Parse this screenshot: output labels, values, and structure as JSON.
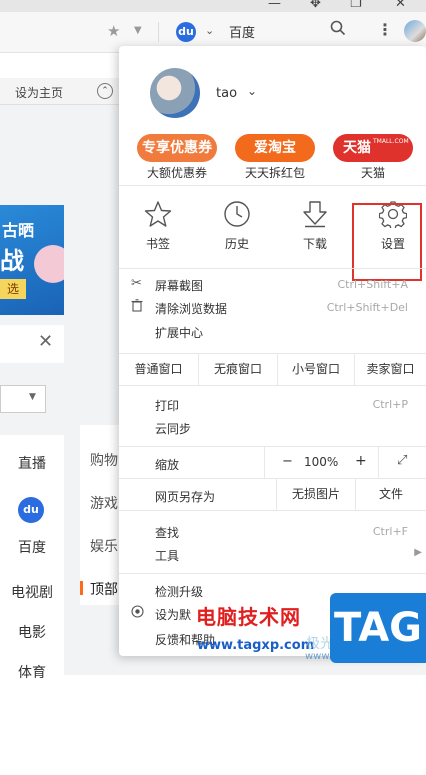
{
  "browser": {
    "address_bar": {
      "star_icon": "star-icon",
      "dropdown_icon": "caret-down-icon"
    },
    "search_engine": {
      "name": "百度",
      "icon": "baidu-paw-icon",
      "icon_text": "du"
    },
    "toolbar": {
      "search_icon": "magnifier-icon",
      "more_icon": "vertical-dots-icon",
      "avatar": "user-avatar"
    },
    "window_controls": {
      "icons": [
        "minimize-icon",
        "pin-icon",
        "restore-icon",
        "close-icon"
      ]
    },
    "bookmarks_bar": {
      "set_home_label": "设为主页",
      "arrow_icon": "circle-arrow-up-icon"
    }
  },
  "page": {
    "banner": {
      "line1": "古晒",
      "line2": "战",
      "button": "选"
    },
    "close_icon": "close-icon",
    "side_nav": [
      "直播",
      "百度",
      "电视剧",
      "电影",
      "体育"
    ],
    "baidu_icon_text": "du",
    "mid_nav": [
      "购物",
      "游戏",
      "娱乐",
      "顶部"
    ]
  },
  "menu": {
    "profile": {
      "username": "tao",
      "caret_icon": "chevron-down-icon"
    },
    "promos": [
      {
        "badge": "专享优惠券",
        "caption": "大额优惠券",
        "color": "#f07b3c"
      },
      {
        "badge": "爱淘宝",
        "caption": "天天拆红包",
        "color": "#f26a1b"
      },
      {
        "badge": "天猫",
        "sub_badge": "TMALL.COM",
        "caption": "天猫",
        "color": "#e0322c"
      }
    ],
    "tools": [
      {
        "label": "书签",
        "icon": "star-outline-icon"
      },
      {
        "label": "历史",
        "icon": "clock-icon"
      },
      {
        "label": "下载",
        "icon": "download-icon"
      },
      {
        "label": "设置",
        "icon": "gear-icon"
      }
    ],
    "highlight_color": "#e0332c",
    "group1": [
      {
        "label": "屏幕截图",
        "shortcut": "Ctrl+Shift+A",
        "icon": "scissors-icon"
      },
      {
        "label": "清除浏览数据",
        "shortcut": "Ctrl+Shift+Del",
        "icon": "trash-icon"
      },
      {
        "label": "扩展中心",
        "shortcut": ""
      }
    ],
    "windows": [
      "普通窗口",
      "无痕窗口",
      "小号窗口",
      "卖家窗口"
    ],
    "group2": [
      {
        "label": "打印",
        "shortcut": "Ctrl+P"
      },
      {
        "label": "云同步",
        "shortcut": ""
      }
    ],
    "zoom": {
      "label": "缩放",
      "minus": "−",
      "value": "100%",
      "plus": "+",
      "fullscreen_icon": "expand-arrows-icon"
    },
    "save_row": {
      "label": "网页另存为",
      "lossless": "无损图片",
      "file": "文件"
    },
    "group3": [
      {
        "label": "查找",
        "shortcut": "Ctrl+F"
      },
      {
        "label": "工具",
        "submenu_icon": "triangle-right-icon"
      }
    ],
    "group4": [
      {
        "label": "检测升级"
      },
      {
        "label": "设为默",
        "icon": "radio-icon"
      },
      {
        "label": "反馈和帮助"
      }
    ]
  },
  "watermark": {
    "title": "电脑技术网",
    "url": "www.tagxp.com",
    "tag": "TAG",
    "faint_text": "极光",
    "url2": "www.xz7.com"
  }
}
